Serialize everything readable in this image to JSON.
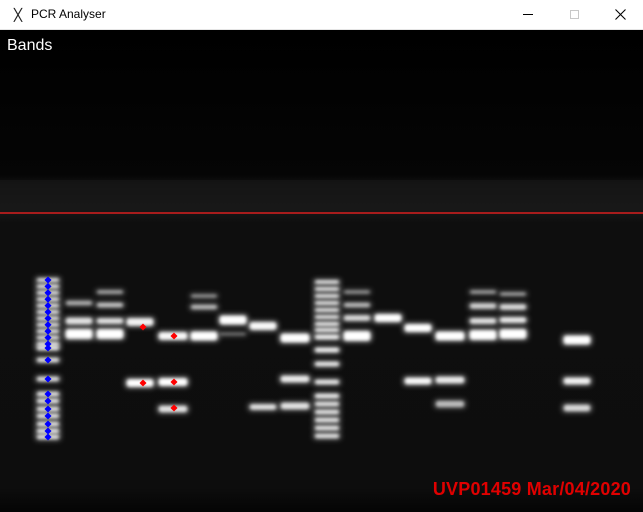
{
  "window": {
    "title": "PCR Analyser",
    "icon": "x-glyph-icon",
    "controls": [
      "minimize",
      "maximize",
      "close"
    ]
  },
  "view": {
    "label": "Bands",
    "stamp": "UVP01459 Mar/04/2020",
    "marker_color": "#ff0000",
    "ladder_marker_color": "#0000ff",
    "reference_line_color": "#ff2020"
  }
}
